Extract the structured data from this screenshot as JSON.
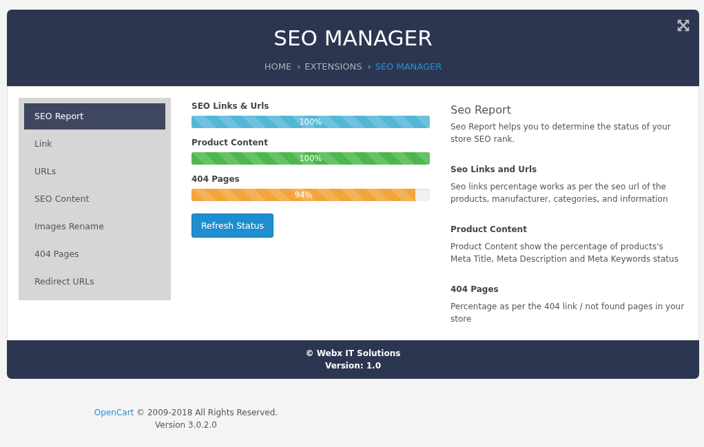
{
  "header": {
    "title": "SEO MANAGER",
    "breadcrumb": [
      {
        "label": "HOME",
        "current": false
      },
      {
        "separator": "›",
        "label": "EXTENSIONS",
        "current": false
      },
      {
        "separator": "›",
        "label": "SEO MANAGER",
        "current": true
      }
    ]
  },
  "sidebar": {
    "items": [
      {
        "label": "SEO Report",
        "selected": true
      },
      {
        "label": "Link",
        "selected": false
      },
      {
        "label": "URLs",
        "selected": false
      },
      {
        "label": "SEO Content",
        "selected": false
      },
      {
        "label": "Images Rename",
        "selected": false
      },
      {
        "label": "404 Pages",
        "selected": false
      },
      {
        "label": "Redirect URLs",
        "selected": false
      }
    ]
  },
  "progress": [
    {
      "label": "SEO Links & Urls",
      "level": 1.0,
      "reading": "100%",
      "color": "#55b7d8"
    },
    {
      "label": "Product Content",
      "level": 1.0,
      "reading": "100%",
      "color": "#4cb74c"
    },
    {
      "label": "404 Pages",
      "level": 0.94,
      "reading": "94%",
      "color": "#f2a53a"
    }
  ],
  "refresh_button": "Refresh Status",
  "report": {
    "title": "Seo Report",
    "intro": "Seo Report helps you to determine the status of your store SEO rank.",
    "sections": [
      {
        "heading": "Seo Links and Urls",
        "text": "Seo links percentage works as per the seo url of the products, manufacturer, categories, and information"
      },
      {
        "heading": "Product Content",
        "text": "Product Content show the percentage of products's Meta Title, Meta Description and Meta Keywords status"
      },
      {
        "heading": "404 Pages",
        "text": "Percentage as per the 404 link / not found pages in your store"
      }
    ]
  },
  "panel_footer": {
    "copyright": "© Webx IT Solutions",
    "version": "Version: 1.0"
  },
  "page_footer": {
    "link": "OpenCart",
    "rights": "© 2009-2018 All Rights Reserved.",
    "version": "Version 3.0.2.0"
  }
}
